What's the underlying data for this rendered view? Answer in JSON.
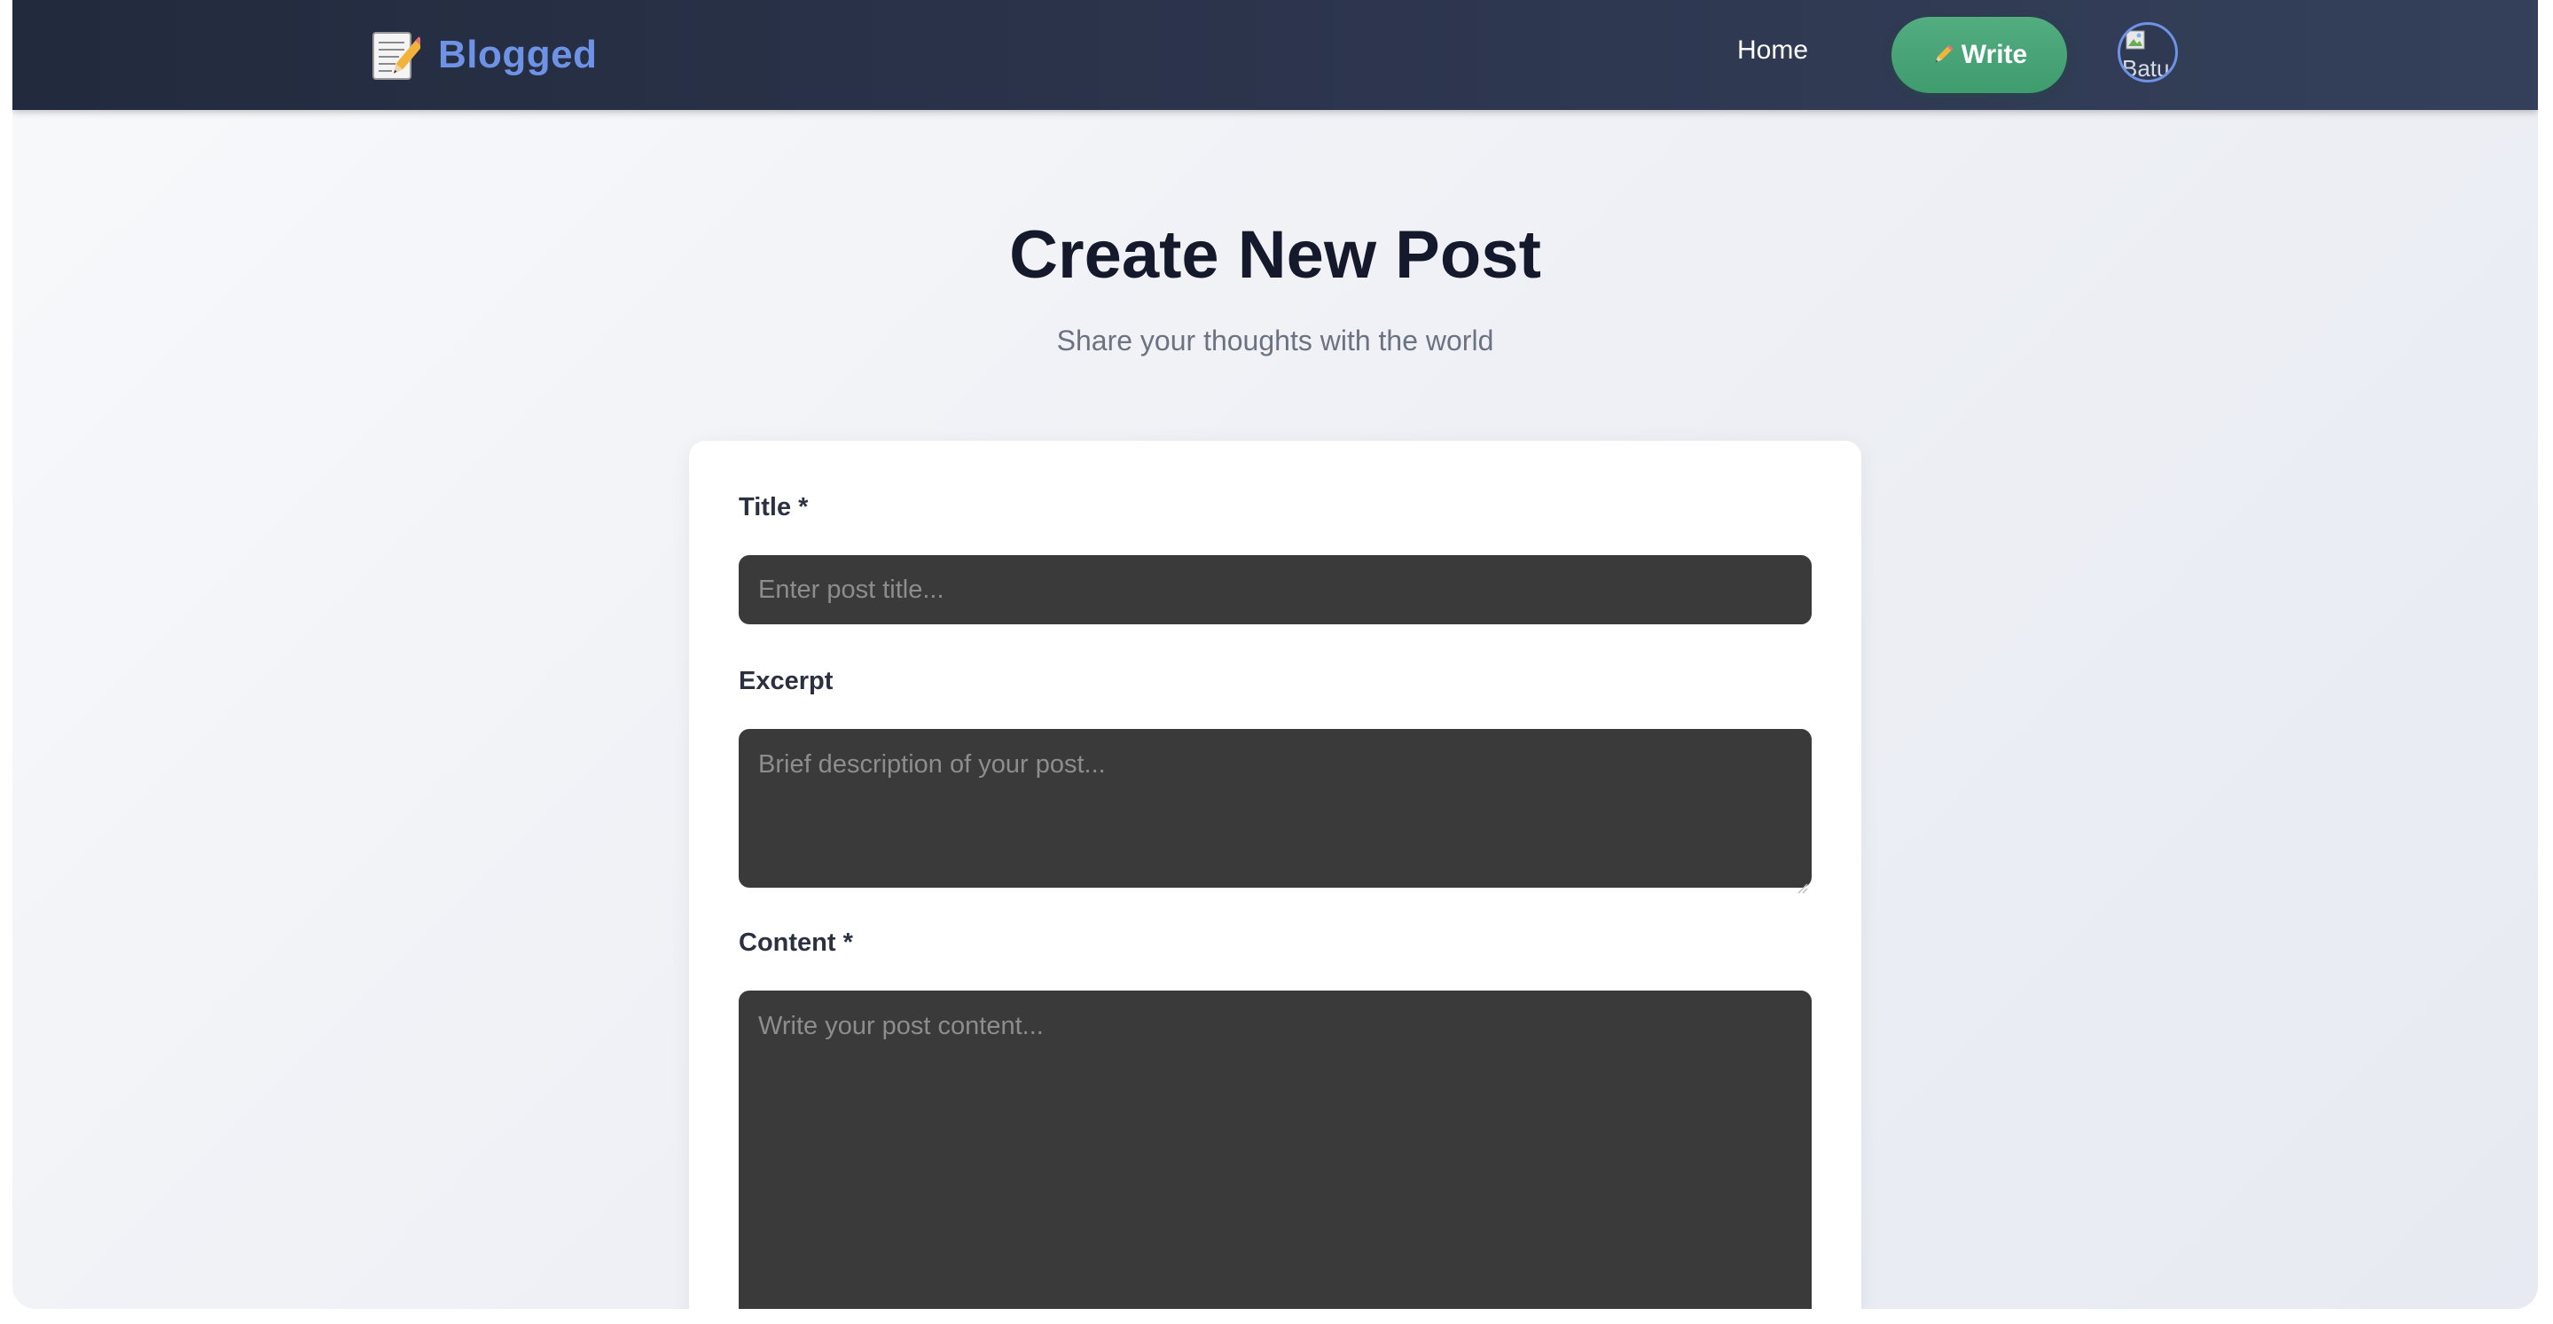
{
  "navbar": {
    "brand": "Blogged",
    "brand_icon": "memo-icon",
    "home_label": "Home",
    "write_label": "Write",
    "write_icon": "pencil-icon",
    "avatar_alt": "Batu",
    "accent_color": "#6e93e6",
    "write_color": "#4aa577"
  },
  "header": {
    "title": "Create New Post",
    "subtitle": "Share your thoughts with the world"
  },
  "form": {
    "title_label": "Title *",
    "title_placeholder": "Enter post title...",
    "excerpt_label": "Excerpt",
    "excerpt_placeholder": "Brief description of your post...",
    "content_label": "Content *",
    "content_placeholder": "Write your post content..."
  }
}
